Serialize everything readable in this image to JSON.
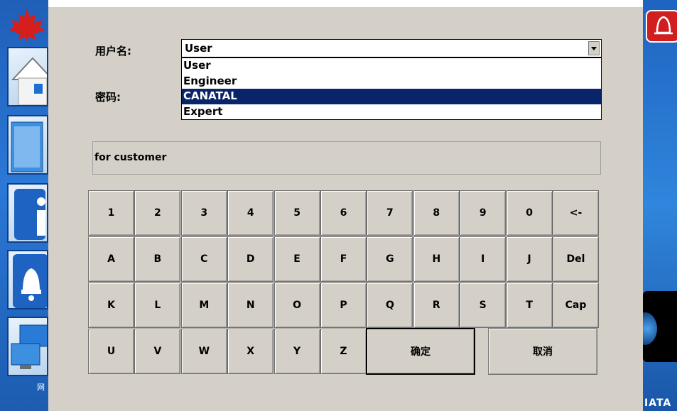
{
  "sidebar": {
    "network_label": "网"
  },
  "right_bar": {
    "brand_text": "IATA"
  },
  "login": {
    "username_label": "用户名:",
    "password_label": "密码:",
    "username_value": "User",
    "options": [
      "User",
      "Engineer",
      "CANATAL",
      "Expert"
    ],
    "highlighted_option": "CANATAL",
    "hint": "for customer"
  },
  "keyboard": {
    "row1": [
      "1",
      "2",
      "3",
      "4",
      "5",
      "6",
      "7",
      "8",
      "9",
      "0",
      "<-"
    ],
    "row2": [
      "A",
      "B",
      "C",
      "D",
      "E",
      "F",
      "G",
      "H",
      "I",
      "J",
      "Del"
    ],
    "row3": [
      "K",
      "L",
      "M",
      "N",
      "O",
      "P",
      "Q",
      "R",
      "S",
      "T",
      "Cap"
    ],
    "row4": [
      "U",
      "V",
      "W",
      "X",
      "Y",
      "Z"
    ],
    "ok_label": "确定",
    "cancel_label": "取消"
  },
  "colors": {
    "panel": "#d4d0c8",
    "selection": "#0a246a",
    "sidebar_blue": "#2b78d6",
    "alarm_red": "#d11f1f"
  },
  "icons": [
    "maple-leaf-icon",
    "home-icon",
    "window-icon",
    "info-icon",
    "bell-icon",
    "network-icon",
    "alarm-bell-icon",
    "dropdown-arrow-icon"
  ]
}
